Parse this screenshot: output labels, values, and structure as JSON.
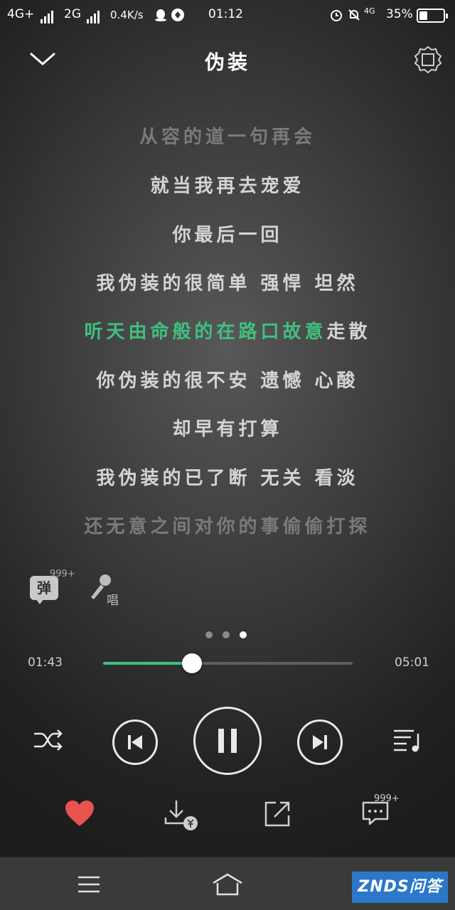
{
  "status": {
    "net1": "4G+",
    "net2": "2G",
    "speed": "0.4K/s",
    "time": "01:12",
    "net_small": "4G",
    "battery": "35%"
  },
  "header": {
    "title": "伪装"
  },
  "lyrics": [
    {
      "text": "从容的道一句再会",
      "state": "dim"
    },
    {
      "text": "就当我再去宠爱",
      "state": "normal"
    },
    {
      "text": "你最后一回",
      "state": "normal"
    },
    {
      "text": "我伪装的很简单 强悍 坦然",
      "state": "normal"
    },
    {
      "sung": "听天由命般的在路口故意",
      "unsung": "走散",
      "state": "current"
    },
    {
      "text": "你伪装的很不安 遗憾 心酸",
      "state": "normal"
    },
    {
      "text": "却早有打算",
      "state": "normal"
    },
    {
      "text": "我伪装的已了断 无关 看淡",
      "state": "normal"
    },
    {
      "text": "还无意之间对你的事偷偷打探",
      "state": "dim"
    }
  ],
  "side_actions": {
    "danmu_label": "弹",
    "danmu_count": "999+",
    "sing_label": "唱"
  },
  "player": {
    "elapsed": "01:43",
    "duration": "05:01",
    "progress": 0.357,
    "page_index": 3,
    "page_count": 3
  },
  "actions": {
    "comment_count": "999+"
  },
  "navbar": {
    "brand": "ZNDS问答"
  },
  "colors": {
    "accent": "#3fc07f",
    "like": "#e8524f",
    "brand": "#2b78c9"
  },
  "icons": [
    "chevron-down-icon",
    "lyrics-settings-icon",
    "microphone-icon",
    "shuffle-icon",
    "previous-icon",
    "pause-icon",
    "next-icon",
    "playlist-icon",
    "heart-icon",
    "download-paid-icon",
    "share-icon",
    "comment-icon",
    "menu-icon",
    "home-icon"
  ]
}
